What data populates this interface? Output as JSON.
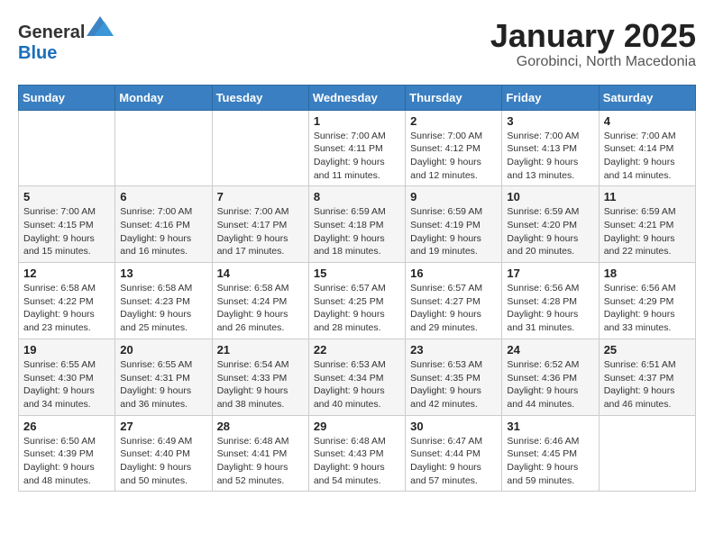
{
  "logo": {
    "general": "General",
    "blue": "Blue"
  },
  "title": "January 2025",
  "subtitle": "Gorobinci, North Macedonia",
  "weekdays": [
    "Sunday",
    "Monday",
    "Tuesday",
    "Wednesday",
    "Thursday",
    "Friday",
    "Saturday"
  ],
  "weeks": [
    [
      {
        "day": "",
        "sunrise": "",
        "sunset": "",
        "daylight": ""
      },
      {
        "day": "",
        "sunrise": "",
        "sunset": "",
        "daylight": ""
      },
      {
        "day": "",
        "sunrise": "",
        "sunset": "",
        "daylight": ""
      },
      {
        "day": "1",
        "sunrise": "Sunrise: 7:00 AM",
        "sunset": "Sunset: 4:11 PM",
        "daylight": "Daylight: 9 hours and 11 minutes."
      },
      {
        "day": "2",
        "sunrise": "Sunrise: 7:00 AM",
        "sunset": "Sunset: 4:12 PM",
        "daylight": "Daylight: 9 hours and 12 minutes."
      },
      {
        "day": "3",
        "sunrise": "Sunrise: 7:00 AM",
        "sunset": "Sunset: 4:13 PM",
        "daylight": "Daylight: 9 hours and 13 minutes."
      },
      {
        "day": "4",
        "sunrise": "Sunrise: 7:00 AM",
        "sunset": "Sunset: 4:14 PM",
        "daylight": "Daylight: 9 hours and 14 minutes."
      }
    ],
    [
      {
        "day": "5",
        "sunrise": "Sunrise: 7:00 AM",
        "sunset": "Sunset: 4:15 PM",
        "daylight": "Daylight: 9 hours and 15 minutes."
      },
      {
        "day": "6",
        "sunrise": "Sunrise: 7:00 AM",
        "sunset": "Sunset: 4:16 PM",
        "daylight": "Daylight: 9 hours and 16 minutes."
      },
      {
        "day": "7",
        "sunrise": "Sunrise: 7:00 AM",
        "sunset": "Sunset: 4:17 PM",
        "daylight": "Daylight: 9 hours and 17 minutes."
      },
      {
        "day": "8",
        "sunrise": "Sunrise: 6:59 AM",
        "sunset": "Sunset: 4:18 PM",
        "daylight": "Daylight: 9 hours and 18 minutes."
      },
      {
        "day": "9",
        "sunrise": "Sunrise: 6:59 AM",
        "sunset": "Sunset: 4:19 PM",
        "daylight": "Daylight: 9 hours and 19 minutes."
      },
      {
        "day": "10",
        "sunrise": "Sunrise: 6:59 AM",
        "sunset": "Sunset: 4:20 PM",
        "daylight": "Daylight: 9 hours and 20 minutes."
      },
      {
        "day": "11",
        "sunrise": "Sunrise: 6:59 AM",
        "sunset": "Sunset: 4:21 PM",
        "daylight": "Daylight: 9 hours and 22 minutes."
      }
    ],
    [
      {
        "day": "12",
        "sunrise": "Sunrise: 6:58 AM",
        "sunset": "Sunset: 4:22 PM",
        "daylight": "Daylight: 9 hours and 23 minutes."
      },
      {
        "day": "13",
        "sunrise": "Sunrise: 6:58 AM",
        "sunset": "Sunset: 4:23 PM",
        "daylight": "Daylight: 9 hours and 25 minutes."
      },
      {
        "day": "14",
        "sunrise": "Sunrise: 6:58 AM",
        "sunset": "Sunset: 4:24 PM",
        "daylight": "Daylight: 9 hours and 26 minutes."
      },
      {
        "day": "15",
        "sunrise": "Sunrise: 6:57 AM",
        "sunset": "Sunset: 4:25 PM",
        "daylight": "Daylight: 9 hours and 28 minutes."
      },
      {
        "day": "16",
        "sunrise": "Sunrise: 6:57 AM",
        "sunset": "Sunset: 4:27 PM",
        "daylight": "Daylight: 9 hours and 29 minutes."
      },
      {
        "day": "17",
        "sunrise": "Sunrise: 6:56 AM",
        "sunset": "Sunset: 4:28 PM",
        "daylight": "Daylight: 9 hours and 31 minutes."
      },
      {
        "day": "18",
        "sunrise": "Sunrise: 6:56 AM",
        "sunset": "Sunset: 4:29 PM",
        "daylight": "Daylight: 9 hours and 33 minutes."
      }
    ],
    [
      {
        "day": "19",
        "sunrise": "Sunrise: 6:55 AM",
        "sunset": "Sunset: 4:30 PM",
        "daylight": "Daylight: 9 hours and 34 minutes."
      },
      {
        "day": "20",
        "sunrise": "Sunrise: 6:55 AM",
        "sunset": "Sunset: 4:31 PM",
        "daylight": "Daylight: 9 hours and 36 minutes."
      },
      {
        "day": "21",
        "sunrise": "Sunrise: 6:54 AM",
        "sunset": "Sunset: 4:33 PM",
        "daylight": "Daylight: 9 hours and 38 minutes."
      },
      {
        "day": "22",
        "sunrise": "Sunrise: 6:53 AM",
        "sunset": "Sunset: 4:34 PM",
        "daylight": "Daylight: 9 hours and 40 minutes."
      },
      {
        "day": "23",
        "sunrise": "Sunrise: 6:53 AM",
        "sunset": "Sunset: 4:35 PM",
        "daylight": "Daylight: 9 hours and 42 minutes."
      },
      {
        "day": "24",
        "sunrise": "Sunrise: 6:52 AM",
        "sunset": "Sunset: 4:36 PM",
        "daylight": "Daylight: 9 hours and 44 minutes."
      },
      {
        "day": "25",
        "sunrise": "Sunrise: 6:51 AM",
        "sunset": "Sunset: 4:37 PM",
        "daylight": "Daylight: 9 hours and 46 minutes."
      }
    ],
    [
      {
        "day": "26",
        "sunrise": "Sunrise: 6:50 AM",
        "sunset": "Sunset: 4:39 PM",
        "daylight": "Daylight: 9 hours and 48 minutes."
      },
      {
        "day": "27",
        "sunrise": "Sunrise: 6:49 AM",
        "sunset": "Sunset: 4:40 PM",
        "daylight": "Daylight: 9 hours and 50 minutes."
      },
      {
        "day": "28",
        "sunrise": "Sunrise: 6:48 AM",
        "sunset": "Sunset: 4:41 PM",
        "daylight": "Daylight: 9 hours and 52 minutes."
      },
      {
        "day": "29",
        "sunrise": "Sunrise: 6:48 AM",
        "sunset": "Sunset: 4:43 PM",
        "daylight": "Daylight: 9 hours and 54 minutes."
      },
      {
        "day": "30",
        "sunrise": "Sunrise: 6:47 AM",
        "sunset": "Sunset: 4:44 PM",
        "daylight": "Daylight: 9 hours and 57 minutes."
      },
      {
        "day": "31",
        "sunrise": "Sunrise: 6:46 AM",
        "sunset": "Sunset: 4:45 PM",
        "daylight": "Daylight: 9 hours and 59 minutes."
      },
      {
        "day": "",
        "sunrise": "",
        "sunset": "",
        "daylight": ""
      }
    ]
  ]
}
